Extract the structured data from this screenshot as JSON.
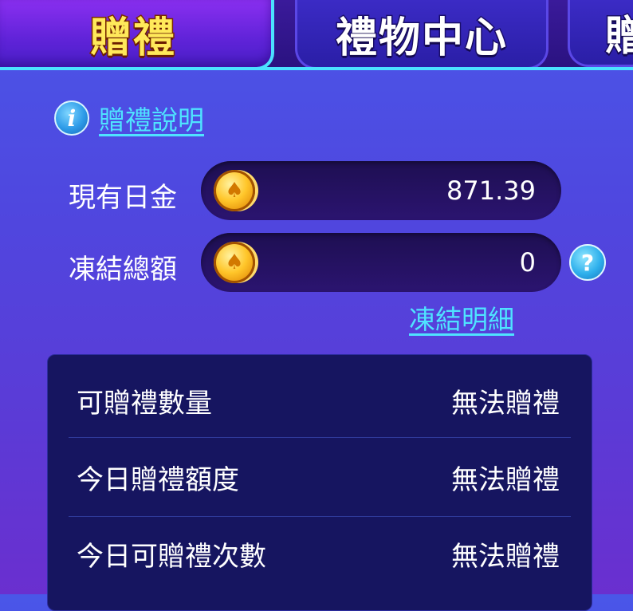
{
  "tabs": [
    {
      "label": "贈禮",
      "active": true
    },
    {
      "label": "禮物中心",
      "active": false
    },
    {
      "label": "贈",
      "active": false
    }
  ],
  "help": {
    "icon": "info-icon",
    "label": "贈禮說明"
  },
  "balances": {
    "current": {
      "label": "現有日金",
      "icon": "coin-icon",
      "value": "871.39"
    },
    "frozen": {
      "label": "凍結總額",
      "icon": "coin-icon",
      "value": "0",
      "help_icon": "question-icon"
    }
  },
  "frozen_detail_link": "凍結明細",
  "gift_info": [
    {
      "label": "可贈禮數量",
      "value": "無法贈禮"
    },
    {
      "label": "今日贈禮額度",
      "value": "無法贈禮"
    },
    {
      "label": "今日可贈禮次數",
      "value": "無法贈禮"
    }
  ],
  "colors": {
    "link": "#4fe3ff",
    "active_tab_text": "#ffe95a",
    "tab_border": "#4be1ff",
    "table_bg": "#161560"
  }
}
